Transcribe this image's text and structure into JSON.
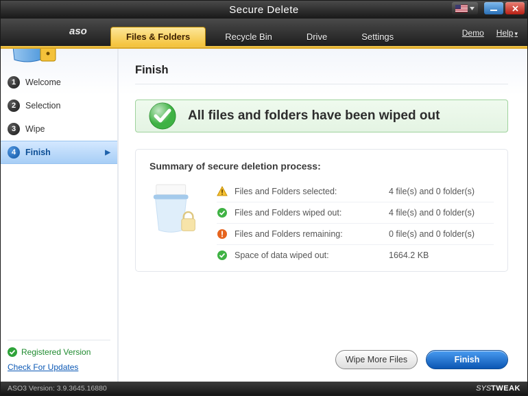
{
  "title": "Secure Delete",
  "brand": "aso",
  "tabs": [
    {
      "label": "Files & Folders",
      "active": true
    },
    {
      "label": "Recycle Bin",
      "active": false
    },
    {
      "label": "Drive",
      "active": false
    },
    {
      "label": "Settings",
      "active": false
    }
  ],
  "menu_links": {
    "demo": "Demo",
    "help": "Help"
  },
  "steps": [
    {
      "num": "1",
      "label": "Welcome",
      "active": false
    },
    {
      "num": "2",
      "label": "Selection",
      "active": false
    },
    {
      "num": "3",
      "label": "Wipe",
      "active": false
    },
    {
      "num": "4",
      "label": "Finish",
      "active": true
    }
  ],
  "sidebar": {
    "registered": "Registered Version",
    "updates": "Check For Updates"
  },
  "heading": "Finish",
  "banner": "All files and folders have been wiped out",
  "summary_heading": "Summary of secure deletion process:",
  "rows": [
    {
      "icon": "warn",
      "label": "Files and Folders selected:",
      "value": "4 file(s) and 0 folder(s)"
    },
    {
      "icon": "check",
      "label": "Files and Folders wiped out:",
      "value": "4 file(s) and 0 folder(s)"
    },
    {
      "icon": "error",
      "label": "Files and Folders remaining:",
      "value": "0 file(s) and 0 folder(s)"
    },
    {
      "icon": "check",
      "label": "Space of data wiped out:",
      "value": "1664.2 KB"
    }
  ],
  "actions": {
    "more": "Wipe More Files",
    "finish": "Finish"
  },
  "status": {
    "version": "ASO3 Version: 3.9.3645.16880",
    "companyA": "SYS",
    "companyB": "TWEAK"
  }
}
